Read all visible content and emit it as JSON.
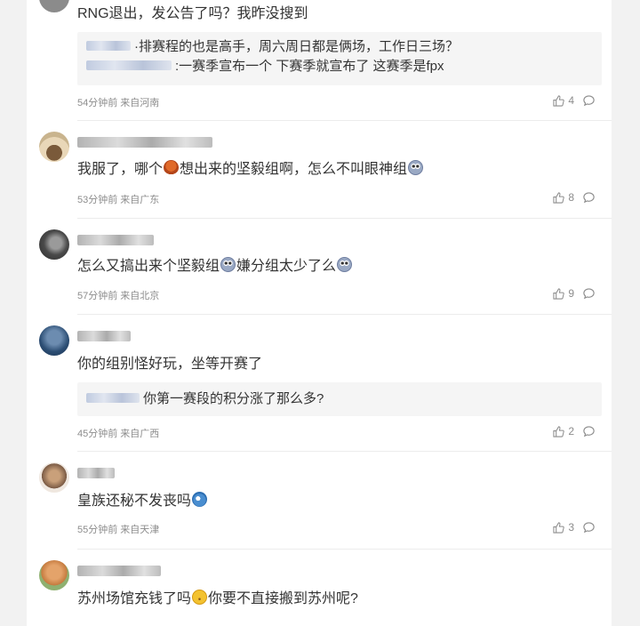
{
  "comments": [
    {
      "text": "RNG退出，发公告了吗？我昨没搜到",
      "quote_lines": [
        "·排赛程的也是高手，周六周日都是俩场，工作日三场？",
        ":一赛季宣布一个 下赛季就宣布了 这赛季是fpx"
      ],
      "meta": "54分钟前 来自河南",
      "likes": "4"
    },
    {
      "text_a": "我服了，哪个",
      "text_b": "想出来的坚毅组啊，怎么不叫眼神组",
      "meta": "53分钟前 来自广东",
      "likes": "8"
    },
    {
      "text_a": "怎么又搞出来个坚毅组",
      "text_b": "嫌分组太少了么",
      "meta": "57分钟前 来自北京",
      "likes": "9"
    },
    {
      "text": "你的组别怪好玩，坐等开赛了",
      "quote_lines": [
        "你第一赛段的积分涨了那么多?"
      ],
      "meta": "45分钟前 来自广西",
      "likes": "2"
    },
    {
      "text": "皇族还秘不发丧吗",
      "meta": "55分钟前 来自天津",
      "likes": "3"
    },
    {
      "text_a": "苏州场馆充钱了吗",
      "text_b": "你要不直接搬到苏州呢?"
    }
  ],
  "icons": {
    "like": "thumbs-up-icon",
    "reply": "comment-bubble-icon",
    "emoji_face": "emoji-face-icon",
    "emoji_octopus": "emoji-octopus-icon",
    "emoji_doge": "emoji-doge-icon",
    "emoji_smirk": "emoji-smirk-icon"
  },
  "colors": {
    "text": "#333333",
    "meta": "#8c8c8c",
    "quote_bg": "#f5f5f5",
    "page_bg": "#f2f2f2"
  }
}
